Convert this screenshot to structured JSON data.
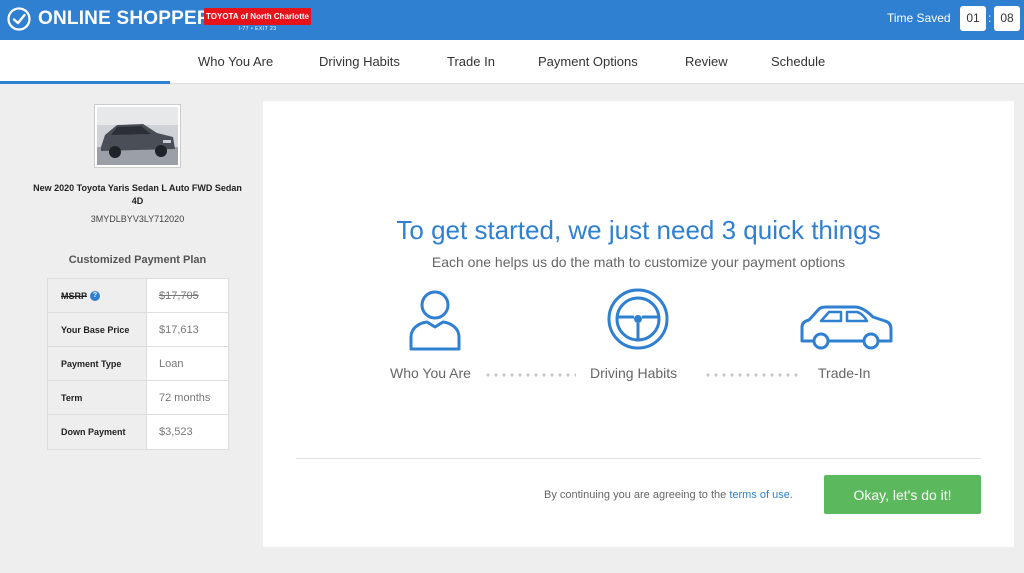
{
  "header": {
    "brand": "ONLINE SHOPPER",
    "dealer_name": "TOYOTA of North Charlotte",
    "dealer_sub": "I-77 • EXIT 23",
    "time_saved_label": "Time Saved",
    "time_hours": "01",
    "time_sep": ":",
    "time_minutes": "08",
    "brand_color": "#2f80d1",
    "dealer_color": "#e8121b"
  },
  "nav": {
    "items": [
      "Who You Are",
      "Driving Habits",
      "Trade In",
      "Payment Options",
      "Review",
      "Schedule"
    ],
    "active_index": 0
  },
  "vehicle": {
    "name": "New 2020 Toyota Yaris Sedan L Auto FWD Sedan 4D",
    "vin": "3MYDLBYV3LY712020"
  },
  "plan": {
    "title": "Customized Payment Plan",
    "rows": [
      {
        "label": "MSRP",
        "value": "$17,705"
      },
      {
        "label": "Your Base Price",
        "value": "$17,613"
      },
      {
        "label": "Payment Type",
        "value": "Loan"
      },
      {
        "label": "Term",
        "value": "72 months"
      },
      {
        "label": "Down Payment",
        "value": "$3,523"
      }
    ],
    "info_glyph": "?"
  },
  "main": {
    "headline": "To get started, we just need 3 quick things",
    "subline": "Each one helps us do the math to customize your payment options",
    "steps": [
      {
        "label": "Who You Are",
        "icon": "person-icon"
      },
      {
        "label": "Driving Habits",
        "icon": "steering-wheel-icon"
      },
      {
        "label": "Trade-In",
        "icon": "car-icon"
      }
    ],
    "consent_text": "By continuing you are agreeing to the",
    "terms_link": "terms of use.",
    "cta_label": "Okay, let's do it!",
    "cta_color": "#5cb85c"
  }
}
